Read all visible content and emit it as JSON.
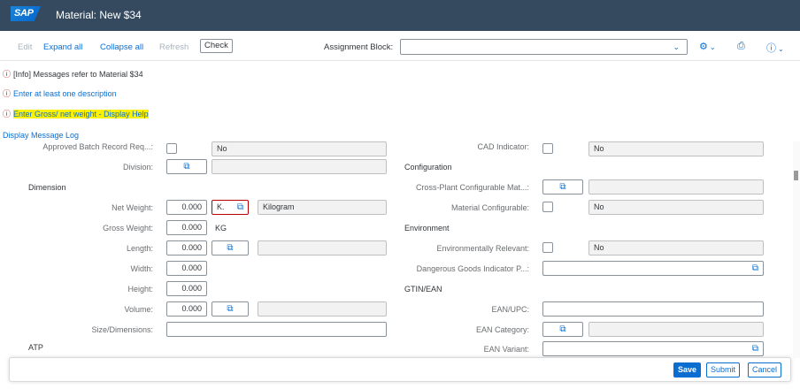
{
  "shell": {
    "logo": "SAP",
    "title": "Material: New $34"
  },
  "toolbar": {
    "edit": "Edit",
    "expand_all": "Expand all",
    "collapse_all": "Collapse all",
    "refresh": "Refresh",
    "check": "Check",
    "assignment_block_label": "Assignment Block:",
    "assignment_block_value": ""
  },
  "messages": {
    "info": "[Info] Messages refer to Material $34",
    "desc": "Enter at least one description",
    "weight_pre": "Enter Gross/ net weight",
    "weight_sep": " - ",
    "weight_help": "Display Help",
    "log": "Display Message Log"
  },
  "form": {
    "batch_label": "Approved Batch Record Req...:",
    "batch_value": "No",
    "division_label": "Division:",
    "dimension_section": "Dimension",
    "net_weight_label": "Net Weight:",
    "net_weight_value": "0.000",
    "net_weight_unit": "K.",
    "net_weight_unit_text": "Kilogram",
    "gross_weight_label": "Gross Weight:",
    "gross_weight_value": "0.000",
    "gross_weight_unit": "KG",
    "length_label": "Length:",
    "length_value": "0.000",
    "width_label": "Width:",
    "width_value": "0.000",
    "height_label": "Height:",
    "height_value": "0.000",
    "volume_label": "Volume:",
    "volume_value": "0.000",
    "size_label": "Size/Dimensions:",
    "atp_section": "ATP",
    "cad_label": "CAD Indicator:",
    "cad_value": "No",
    "configuration_section": "Configuration",
    "cross_plant_label": "Cross-Plant Configurable Mat...:",
    "mat_config_label": "Material Configurable:",
    "mat_config_value": "No",
    "environment_section": "Environment",
    "env_relevant_label": "Environmentally Relevant:",
    "env_relevant_value": "No",
    "dangerous_label": "Dangerous Goods Indicator P...:",
    "gtin_section": "GTIN/EAN",
    "ean_upc_label": "EAN/UPC:",
    "ean_category_label": "EAN Category:",
    "ean_variant_label": "EAN Variant:"
  },
  "footer": {
    "save": "Save",
    "submit": "Submit",
    "cancel": "Cancel"
  },
  "icons": {
    "error": "error-icon",
    "value_help": "value-help-icon",
    "settings": "gear-icon",
    "print": "print-icon",
    "help": "help-icon",
    "dropdown": "chevron-down-icon"
  },
  "colors": {
    "shell": "#354a5f",
    "accent": "#0a6ed1",
    "error": "#bb0000",
    "highlight": "#fff200"
  }
}
